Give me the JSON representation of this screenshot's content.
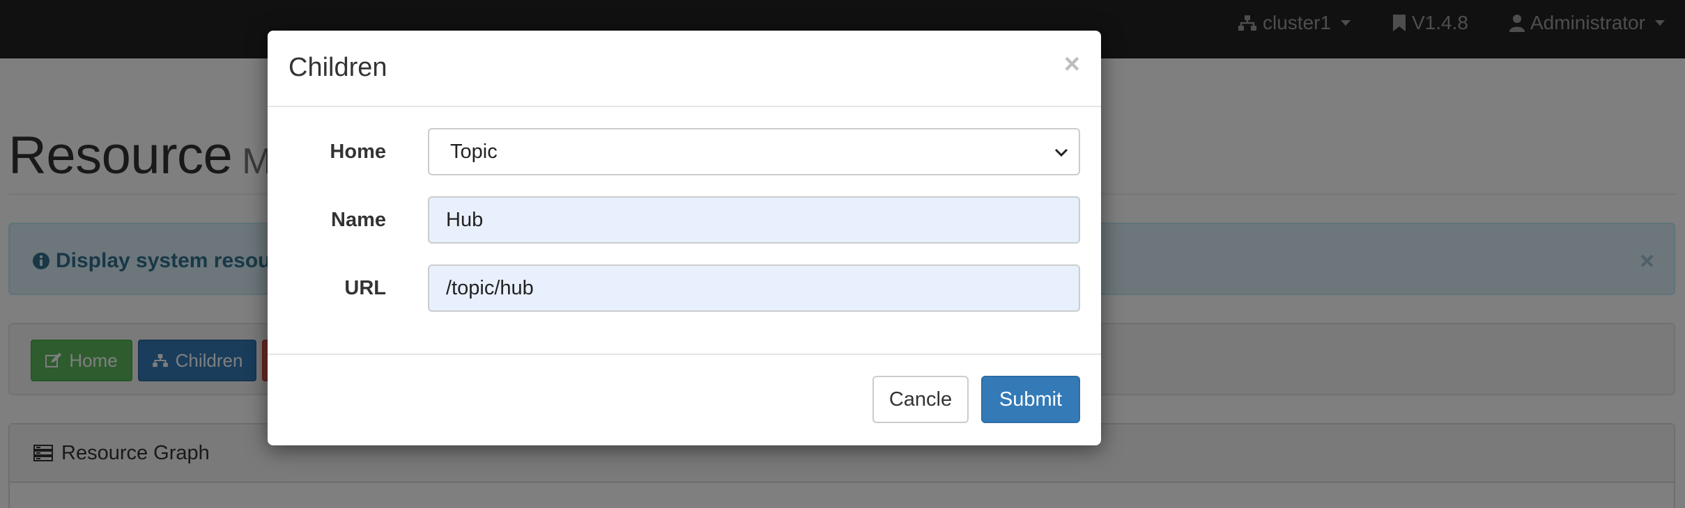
{
  "navbar": {
    "cluster_label": "cluster1",
    "version_label": "V1.4.8",
    "user_label": "Administrator"
  },
  "page": {
    "title": "Resource",
    "subtitle": "M"
  },
  "alert": {
    "text": "Display system resourc",
    "close": "×"
  },
  "toolbar": {
    "home_label": "Home",
    "children_label": "Children"
  },
  "panel": {
    "heading": "Resource Graph"
  },
  "modal": {
    "title": "Children",
    "close": "×",
    "fields": {
      "home": {
        "label": "Home",
        "value": "Topic"
      },
      "name": {
        "label": "Name",
        "value": "Hub"
      },
      "url": {
        "label": "URL",
        "value": "/topic/hub"
      }
    },
    "cancel_label": "Cancle",
    "submit_label": "Submit"
  },
  "colors": {
    "navbar": "#222222",
    "primary": "#337ab7",
    "success": "#5cb85c",
    "danger": "#d9534f",
    "info_bg": "#d9edf7",
    "autofill_bg": "#e8f0fe"
  },
  "icons": {
    "cluster": "sitemap-icon",
    "version": "bookmark-icon",
    "user": "user-icon",
    "alert": "info-circle-icon",
    "home_button": "edit-icon",
    "children_button": "sitemap-icon",
    "panel": "server-icon"
  }
}
